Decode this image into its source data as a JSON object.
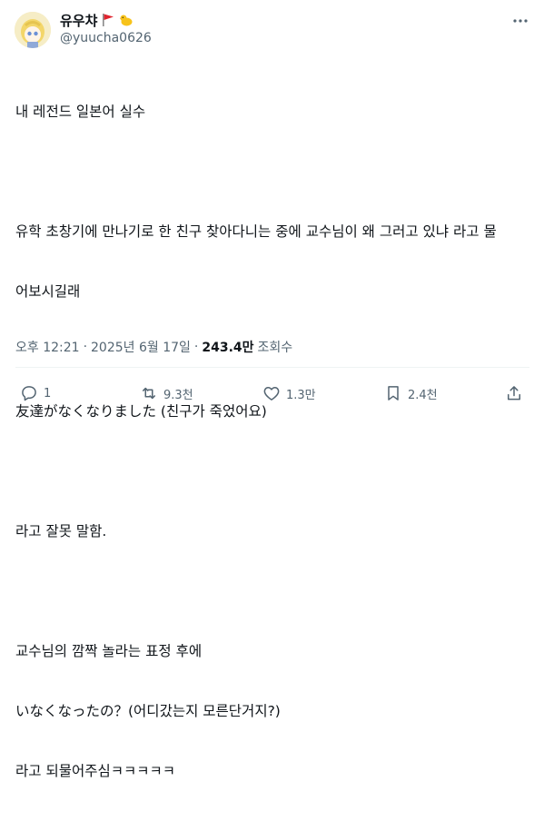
{
  "author": {
    "display_name": "유우챠",
    "handle": "@yuucha0626",
    "badges": [
      "red-flag-emoji",
      "chick-emoji"
    ]
  },
  "tweet": {
    "lines": [
      "내 레전드 일본어 실수",
      "",
      "유학 초창기에 만나기로 한 친구 찾아다니는 중에 교수님이 왜 그러고 있냐 라고 물",
      "어보시길래",
      "",
      "友達がなくなりました (친구가 죽었어요)",
      "",
      "라고 잘못 말함.",
      "",
      "교수님의 깜짝 놀라는 표정 후에",
      "いなくなったの？(어디갔는지 모른단거지?)",
      "라고 되물어주심ㅋㅋㅋㅋㅋ"
    ]
  },
  "meta": {
    "time": "오후 12:21",
    "sep1": "·",
    "date": "2025년 6월 17일",
    "sep2": "·",
    "views": "243.4만",
    "views_label": "조회수"
  },
  "actions": {
    "reply_count": "1",
    "retweet_count": "9.3천",
    "like_count": "1.3만",
    "bookmark_count": "2.4천"
  },
  "icons": {
    "more": "more-horizontal-icon",
    "reply": "reply-icon",
    "retweet": "retweet-icon",
    "like": "heart-icon",
    "bookmark": "bookmark-icon",
    "share": "share-icon"
  },
  "colors": {
    "text": "#0f1419",
    "secondary": "#536471",
    "divider": "#eff3f4"
  }
}
